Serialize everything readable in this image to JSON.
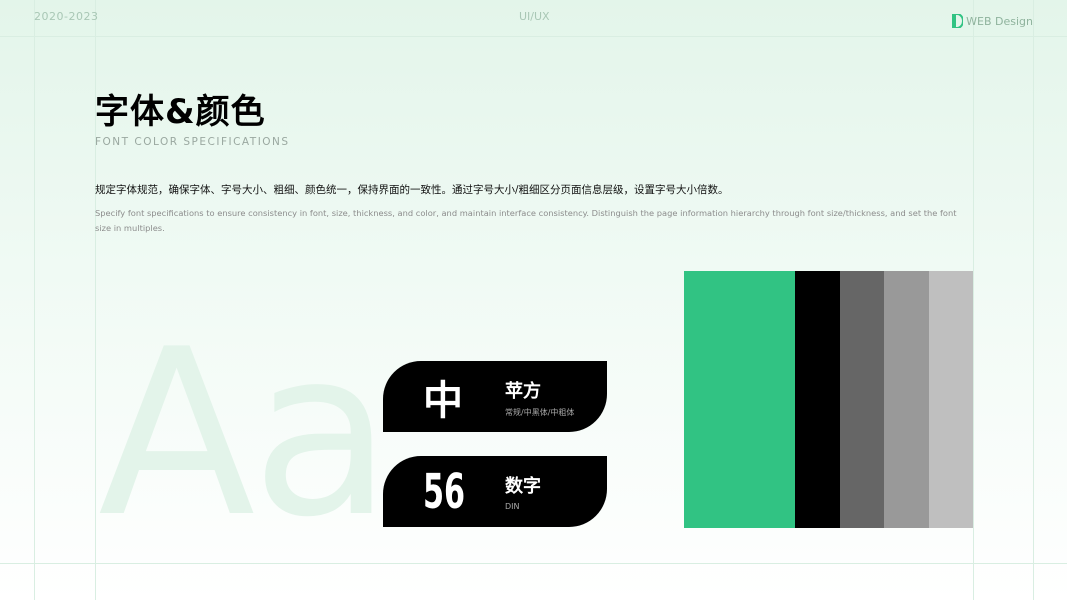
{
  "header": {
    "year_range": "2020-2023",
    "section": "UI/UX",
    "brand": "WEB Design"
  },
  "hero": {
    "title": "字体&颜色",
    "subtitle": "FONT COLOR SPECIFICATIONS"
  },
  "description": {
    "cn": "规定字体规范，确保字体、字号大小、粗细、颜色统一，保持界面的一致性。通过字号大小/粗细区分页面信息层级，设置字号大小倍数。",
    "en": "Specify font specifications to ensure consistency in font, size, thickness, and color, and maintain interface consistency. Distinguish the page information hierarchy through font size/thickness, and set the font size in multiples."
  },
  "watermark": "Aa",
  "fonts": [
    {
      "sample": "中",
      "name": "苹方",
      "weights": "常规/中黑体/中粗体"
    },
    {
      "sample": "56",
      "name": "数字",
      "weights": "DIN"
    }
  ],
  "palette": [
    "#31c383",
    "#000000",
    "#666666",
    "#999999",
    "#bfbfbf"
  ],
  "colors": {
    "accent": "#31c383",
    "guide": "#d9eee2"
  }
}
